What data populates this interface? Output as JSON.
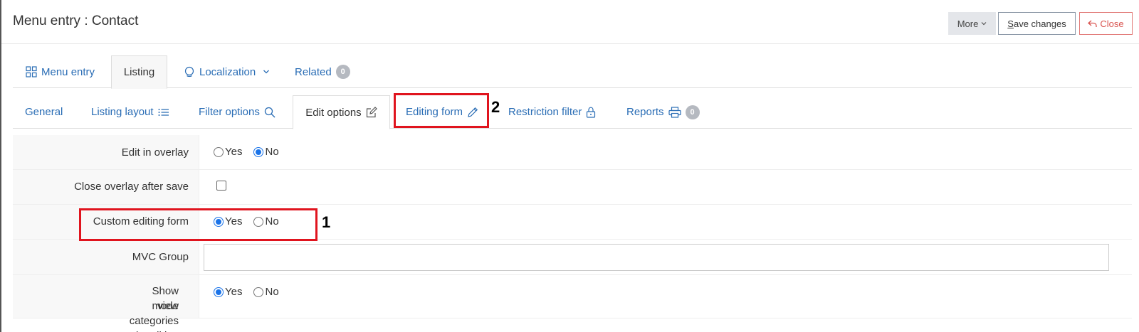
{
  "header": {
    "title": "Menu entry : Contact",
    "more_label": "More",
    "save_label_prefix": "S",
    "save_label_rest": "ave changes",
    "close_label": "Close"
  },
  "main_tabs": [
    {
      "label": "Menu entry",
      "icon": "grid-icon"
    },
    {
      "label": "Listing"
    },
    {
      "label": "Localization",
      "icon": "globe-icon"
    },
    {
      "label": "Related",
      "badge": "0"
    }
  ],
  "sub_tabs": [
    {
      "label": "General"
    },
    {
      "label": "Listing layout",
      "icon": "list-icon"
    },
    {
      "label": "Filter options",
      "icon": "search-icon"
    },
    {
      "label": "Edit options",
      "icon": "edit-icon"
    },
    {
      "label": "Editing form",
      "icon": "pencil-icon"
    },
    {
      "label": "Restriction filter",
      "icon": "lock-icon"
    },
    {
      "label": "Reports",
      "icon": "printer-icon",
      "badge": "0"
    }
  ],
  "form": {
    "edit_in_overlay": {
      "label": "Edit in overlay",
      "yes": "Yes",
      "no": "No",
      "value": "No"
    },
    "close_overlay": {
      "label": "Close overlay after save",
      "checked": false
    },
    "custom_form": {
      "label": "Custom editing form",
      "yes": "Yes",
      "no": "No",
      "value": "Yes"
    },
    "mvc_group": {
      "label": "MVC Group",
      "value": ""
    },
    "show_view_categories": {
      "label_line1": "Show view categories in editing",
      "label_line2": "mode",
      "yes": "Yes",
      "no": "No",
      "value": "Yes"
    }
  },
  "annotations": [
    "1",
    "2"
  ],
  "colors": {
    "link": "#2a6db5",
    "highlight": "#e0141e",
    "radio_accent": "#1a73e8",
    "close": "#d9534f"
  }
}
